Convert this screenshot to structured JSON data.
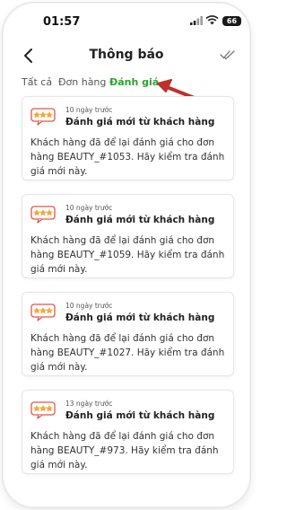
{
  "status": {
    "time": "01:57",
    "battery": "66"
  },
  "header": {
    "title": "Thông báo"
  },
  "tabs": [
    {
      "label": "Tất cả",
      "active": false
    },
    {
      "label": "Đơn hàng",
      "active": false
    },
    {
      "label": "Đánh giá",
      "active": true
    }
  ],
  "notifications": [
    {
      "ago": "10 ngày trước",
      "title": "Đánh giá mới từ khách hàng",
      "body": "Khách hàng đã để lại đánh giá cho đơn hàng BEAUTY_#1053. Hãy kiểm tra đánh giá mới này."
    },
    {
      "ago": "10 ngày trước",
      "title": "Đánh giá mới từ khách hàng",
      "body": "Khách hàng đã để lại đánh giá cho đơn hàng BEAUTY_#1059. Hãy kiểm tra đánh giá mới này."
    },
    {
      "ago": "10 ngày trước",
      "title": "Đánh giá mới từ khách hàng",
      "body": "Khách hàng đã để lại đánh giá cho đơn hàng BEAUTY_#1027. Hãy kiểm tra đánh giá mới này."
    },
    {
      "ago": "13 ngày trước",
      "title": "Đánh giá mới từ khách hàng",
      "body": "Khách hàng đã để lại đánh giá cho đơn hàng BEAUTY_#973. Hãy kiểm tra đánh giá mới này."
    }
  ],
  "icons": {
    "back": "chevron-left-icon",
    "mark_read": "double-check-icon",
    "review": "review-stars-icon",
    "annotation": "red-arrow-icon"
  },
  "colors": {
    "active_tab": "#2aa52a",
    "arrow": "#c0302a",
    "star": "#f2a93b",
    "review_icon_outline": "#e0564a"
  }
}
